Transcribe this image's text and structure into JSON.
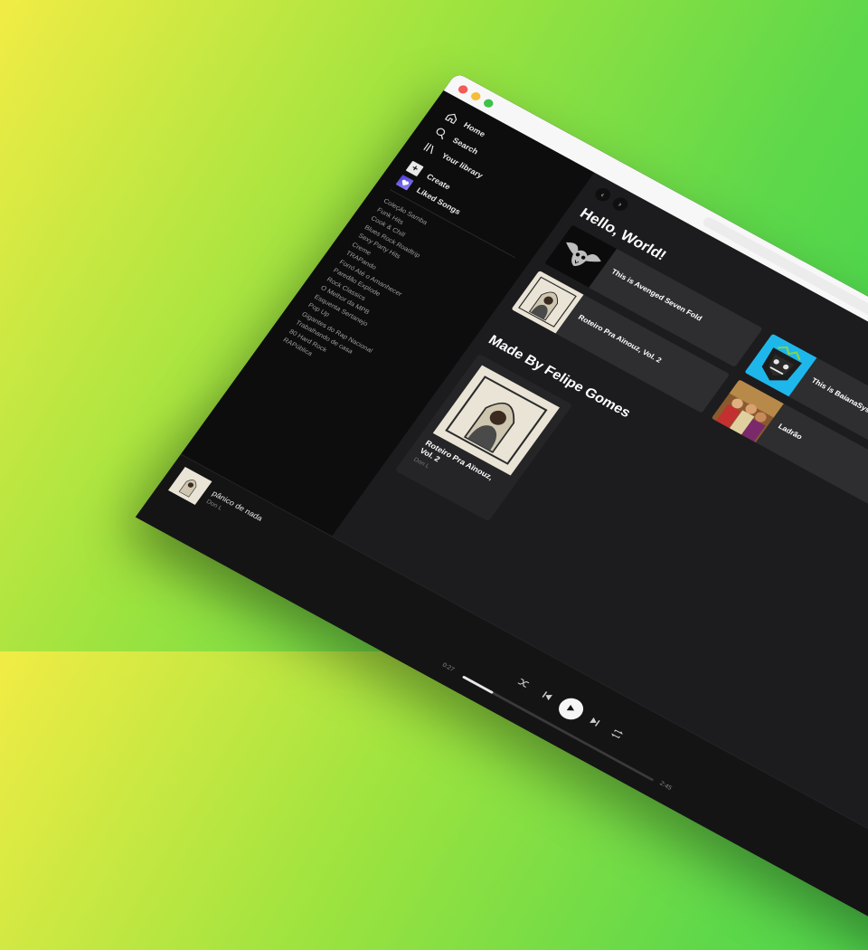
{
  "nav": {
    "home": "Home",
    "search": "Search",
    "library": "Your library",
    "create": "Create",
    "liked": "Liked Songs"
  },
  "playlists": [
    "Coleção Samba",
    "Funk Hits",
    "Cook & Chill",
    "Blues Rock Roadtrip",
    "Sexy Party Hits",
    "Creme",
    "TRAPando",
    "Forró Até o Amanhecer",
    "Paredão Explode",
    "Rock Classics",
    "O Melhor da MPB",
    "Esquenta Sertanejo",
    "Pop Up",
    "Gigantes do Rap Nacional",
    "Trabalhando de casa",
    "80 Hard Rock",
    "RAPública"
  ],
  "main": {
    "greeting": "Hello, World!",
    "back_arrow": "‹",
    "forward_arrow": "›",
    "shortcuts": [
      {
        "label": "This is Avenged Seven Fold",
        "art": "avenged"
      },
      {
        "label": "This is BaianaSystem",
        "art": "baiana"
      },
      {
        "label": "Roteiro Pra Aïnouz, Vol. 2",
        "art": "roteiro"
      },
      {
        "label": "Ladrão",
        "art": "ladrao"
      }
    ],
    "section_title": "Made By Felipe Gomes",
    "card": {
      "title": "Roteiro Pra Aïnouz, Vol. 2",
      "subtitle": "Don L"
    }
  },
  "player": {
    "title": "pânico de nada",
    "artist": "Don L",
    "time_elapsed": "0:27",
    "time_total": "2:45",
    "progress": 0.16
  },
  "colors": {
    "accent": "#3fd24e",
    "background_main": "#1c1c1e",
    "sidebar": "#0d0d0e",
    "shortcut_tile": "#2e2e30",
    "liked_songs": "#4b3bd9"
  }
}
